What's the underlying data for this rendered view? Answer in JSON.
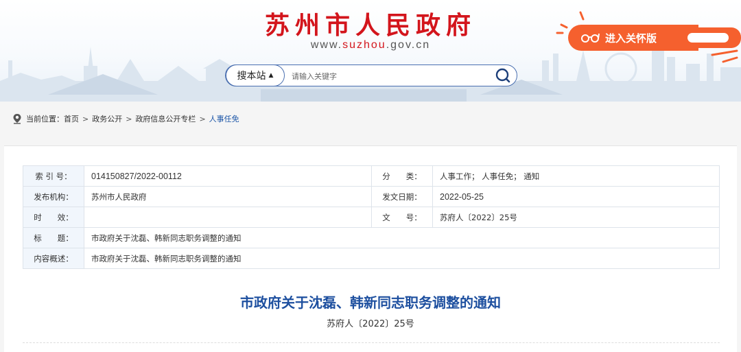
{
  "header": {
    "title": "苏州市人民政府",
    "url_prefix": "www.",
    "url_brand": "suzhou",
    "url_suffix": ".gov.cn",
    "care_mode_label": "进入关怀版",
    "care_icon": "glasses-icon",
    "accent_red": "#d3151c",
    "accent_orange": "#f5602e"
  },
  "search": {
    "scope_label": "搜本站",
    "scope_icon": "caret-up-icon",
    "placeholder": "请输入关键字",
    "button_icon": "search-icon"
  },
  "breadcrumb": {
    "icon": "location-pin-icon",
    "prefix": "当前位置：",
    "items": [
      "首页",
      "政务公开",
      "政府信息公开专栏",
      "人事任免"
    ],
    "separator": ">"
  },
  "meta": {
    "index_label": "索 引 号：",
    "index_value": "014150827/2022-00112",
    "category_label": "分　　类：",
    "category_value": "人事工作； 人事任免； 通知",
    "publisher_label": "发布机构：",
    "publisher_value": "苏州市人民政府",
    "date_label": "发文日期：",
    "date_value": "2022-05-25",
    "validity_label": "时　　效：",
    "validity_value": "",
    "docno_label": "文　　号：",
    "docno_value": "苏府人〔2022〕25号",
    "title_label": "标　　题：",
    "title_value": "市政府关于沈磊、韩新同志职务调整的通知",
    "summary_label": "内容概述：",
    "summary_value": "市政府关于沈磊、韩新同志职务调整的通知"
  },
  "document": {
    "title": "市政府关于沈磊、韩新同志职务调整的通知",
    "number": "苏府人〔2022〕25号",
    "title_color": "#1d4f9f"
  }
}
